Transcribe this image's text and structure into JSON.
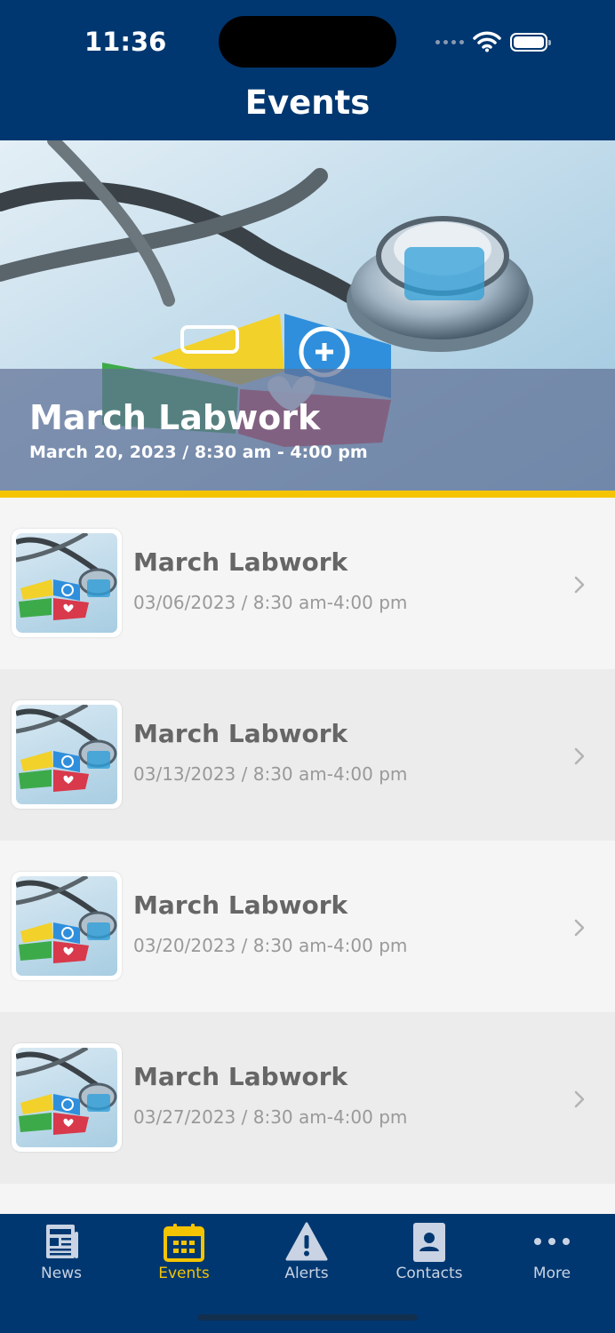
{
  "status_bar": {
    "time": "11:36"
  },
  "header": {
    "title": "Events"
  },
  "featured": {
    "title": "March Labwork",
    "date": "March 20, 2023 / 8:30 am - 4:00 pm"
  },
  "events": [
    {
      "title": "March Labwork",
      "date": "03/06/2023 / 8:30 am-4:00 pm"
    },
    {
      "title": "March Labwork",
      "date": "03/13/2023 / 8:30 am-4:00 pm"
    },
    {
      "title": "March Labwork",
      "date": "03/20/2023 / 8:30 am-4:00 pm"
    },
    {
      "title": "March Labwork",
      "date": "03/27/2023 / 8:30 am-4:00 pm"
    }
  ],
  "tabs": [
    {
      "label": "News",
      "icon": "newspaper-icon"
    },
    {
      "label": "Events",
      "icon": "calendar-icon",
      "active": true
    },
    {
      "label": "Alerts",
      "icon": "warning-icon"
    },
    {
      "label": "Contacts",
      "icon": "contact-card-icon"
    },
    {
      "label": "More",
      "icon": "more-dots-icon"
    }
  ],
  "colors": {
    "brand": "#003770",
    "accent": "#f5c400"
  }
}
